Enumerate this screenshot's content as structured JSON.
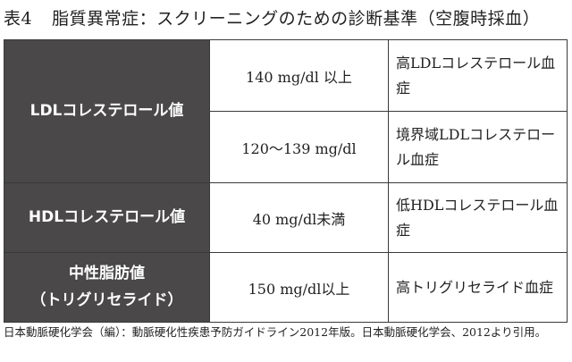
{
  "title": {
    "number": "表4",
    "text": "脂質異常症：スクリーニングのための診断基準（空腹時採血）"
  },
  "table": {
    "rows": [
      {
        "category": "LDLコレステロール値",
        "criteria": [
          {
            "value": "140 mg/dl 以上",
            "diagnosis": "高LDLコレステロール血症"
          },
          {
            "value": "120〜139 mg/dl",
            "diagnosis": "境界域LDLコレステロール血症"
          }
        ]
      },
      {
        "category": "HDLコレステロール値",
        "criteria": [
          {
            "value": "40 mg/dl未満",
            "diagnosis": "低HDLコレステロール血症"
          }
        ]
      },
      {
        "category_lines": [
          "中性脂肪値",
          "（トリグリセライド）"
        ],
        "criteria": [
          {
            "value": "150 mg/dl以上",
            "diagnosis": "高トリグリセライド血症"
          }
        ]
      }
    ]
  },
  "footnote": "日本動脈硬化学会（編）：動脈硬化性疾患予防ガイドライン2012年版。日本動脈硬化学会、2012より引用。"
}
